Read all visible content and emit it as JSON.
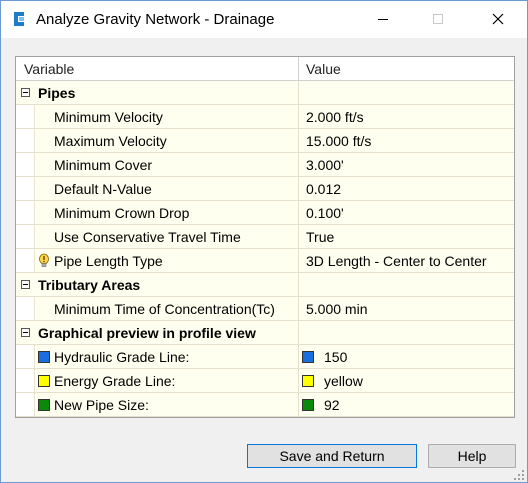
{
  "window": {
    "title": "Analyze Gravity Network - Drainage"
  },
  "grid": {
    "headers": {
      "variable": "Variable",
      "value": "Value"
    },
    "pipes": {
      "category": "Pipes",
      "rows": [
        {
          "label": "Minimum Velocity",
          "value": "2.000 ft/s"
        },
        {
          "label": "Maximum Velocity",
          "value": "15.000 ft/s"
        },
        {
          "label": "Minimum Cover",
          "value": "3.000'"
        },
        {
          "label": "Default N-Value",
          "value": "0.012"
        },
        {
          "label": "Minimum Crown Drop",
          "value": "0.100'"
        },
        {
          "label": "Use Conservative Travel Time",
          "value": "True"
        },
        {
          "label": "Pipe Length Type",
          "value": "3D Length - Center to Center"
        }
      ]
    },
    "tributary": {
      "category": "Tributary Areas",
      "rows": [
        {
          "label": "Minimum Time of Concentration(Tc)",
          "value": "5.000 min"
        }
      ]
    },
    "graphical": {
      "category": "Graphical preview in profile view",
      "rows": [
        {
          "label": "Hydraulic Grade Line:",
          "value": "150",
          "color": "#1a6fe0"
        },
        {
          "label": "Energy Grade Line:",
          "value": "yellow",
          "color": "#ffff00"
        },
        {
          "label": "New Pipe Size:",
          "value": "92",
          "color": "#0a8a0a"
        }
      ]
    }
  },
  "buttons": {
    "save": "Save and Return",
    "help": "Help"
  },
  "colors": {
    "accent": "#0078d7",
    "row_bg": "#fffff0"
  }
}
